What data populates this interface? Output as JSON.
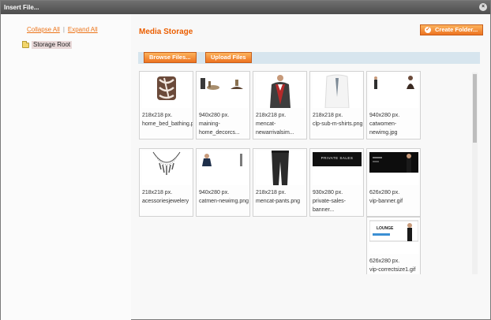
{
  "dialog": {
    "title": "Insert File...",
    "close_icon": "×"
  },
  "sidebar": {
    "collapse_all": "Collapse All",
    "separator": "|",
    "expand_all": "Expand All",
    "root_label": "Storage Root"
  },
  "main": {
    "title": "Media Storage",
    "create_folder_label": "Create Folder...",
    "browse_label": "Browse Files...",
    "upload_label": "Upload Files"
  },
  "files": [
    {
      "size": "218x218 px.",
      "name": "home_bed_bathing.p"
    },
    {
      "size": "940x280 px.",
      "name": "maining-",
      "name2": "home_decorcs..."
    },
    {
      "size": "218x218 px.",
      "name": "mencat-",
      "name2": "newarrivalsim..."
    },
    {
      "size": "218x218 px.",
      "name": "clp-sub-m-shirts.png"
    },
    {
      "size": "940x280 px.",
      "name": "catwomen-",
      "name2": "newimg.jpg"
    },
    {
      "size": "218x218 px.",
      "name": "acessoriesjewelery"
    },
    {
      "size": "940x280 px.",
      "name": "catmen-newimg.png"
    },
    {
      "size": "218x218 px.",
      "name": "mencat-pants.png"
    },
    {
      "size": "930x280 px.",
      "name": "private-sales-",
      "name2": "banner..."
    },
    {
      "size": "626x280 px.",
      "name": "vip-banner.gif"
    },
    {
      "size": "626x280 px.",
      "name": "vip-correctsize1.gif"
    }
  ],
  "thumb_text": {
    "private_sales": "PRIVATE SALES",
    "lounge": "LOUNGE"
  }
}
